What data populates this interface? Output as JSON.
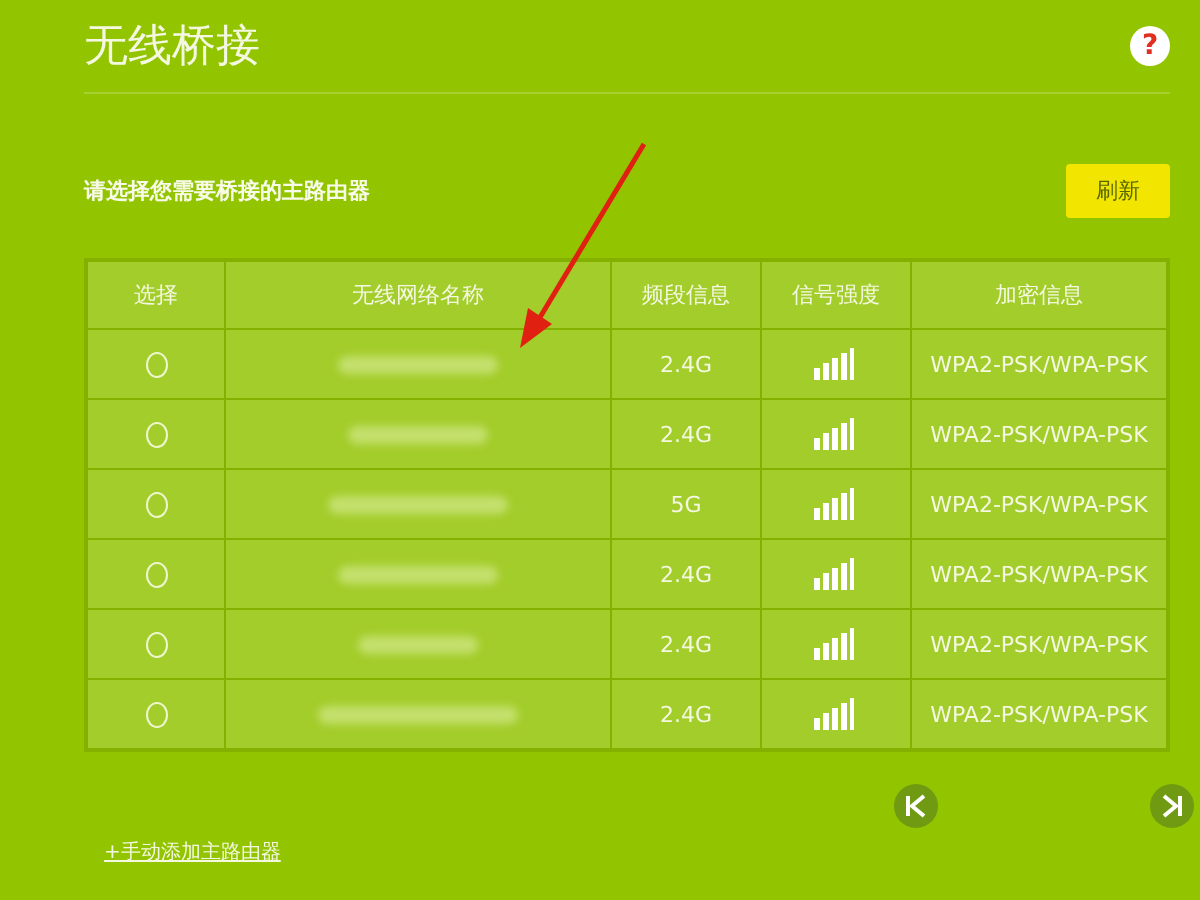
{
  "page": {
    "title": "无线桥接",
    "help": "?",
    "subtitle": "请选择您需要桥接的主路由器",
    "refresh_button": "刷新",
    "add_link": "+手动添加主路由器"
  },
  "table": {
    "columns": [
      "选择",
      "无线网络名称",
      "频段信息",
      "信号强度",
      "加密信息"
    ],
    "rows": [
      {
        "selected": false,
        "band": "2.4G",
        "security": "WPA2-PSK/WPA-PSK"
      },
      {
        "selected": false,
        "band": "2.4G",
        "security": "WPA2-PSK/WPA-PSK"
      },
      {
        "selected": false,
        "band": "5G",
        "security": "WPA2-PSK/WPA-PSK"
      },
      {
        "selected": false,
        "band": "2.4G",
        "security": "WPA2-PSK/WPA-PSK"
      },
      {
        "selected": false,
        "band": "2.4G",
        "security": "WPA2-PSK/WPA-PSK"
      },
      {
        "selected": false,
        "band": "2.4G",
        "security": "WPA2-PSK/WPA-PSK"
      }
    ]
  }
}
